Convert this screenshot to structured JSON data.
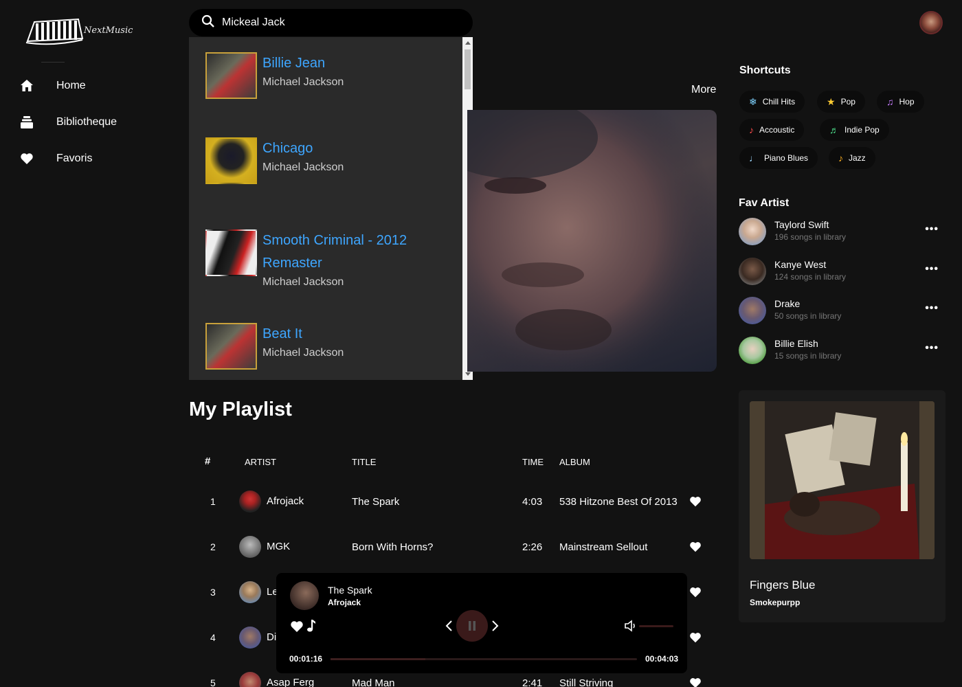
{
  "app": {
    "logo_text": "NextMusic"
  },
  "sidebar": {
    "items": [
      {
        "label": "Home",
        "icon": "home-icon"
      },
      {
        "label": "Bibliotheque",
        "icon": "library-icon"
      },
      {
        "label": "Favoris",
        "icon": "heart-icon"
      }
    ]
  },
  "search": {
    "value": "Mickeal Jack"
  },
  "results": [
    {
      "title": "Billie Jean",
      "artist": "Michael Jackson"
    },
    {
      "title": "Chicago",
      "artist": "Michael Jackson"
    },
    {
      "title": "Smooth Criminal - 2012 Remaster",
      "artist": "Michael Jackson"
    },
    {
      "title": "Beat It",
      "artist": "Michael Jackson"
    }
  ],
  "hero": {
    "more_label": "More"
  },
  "playlist": {
    "title": "My Playlist",
    "headers": {
      "num": "#",
      "artist": "ARTIST",
      "title": "TITLE",
      "time": "TIME",
      "album": "ALBUM"
    },
    "rows": [
      {
        "num": "1",
        "artist": "Afrojack",
        "title": "The Spark",
        "time": "4:03",
        "album": "538 Hitzone Best Of 2013"
      },
      {
        "num": "2",
        "artist": "MGK",
        "title": "Born With Horns?",
        "time": "2:26",
        "album": "Mainstream Sellout"
      },
      {
        "num": "3",
        "artist": "Le",
        "title": "",
        "time": "",
        "album": ""
      },
      {
        "num": "4",
        "artist": "Di",
        "title": "",
        "time": "",
        "album": ""
      },
      {
        "num": "5",
        "artist": "Asap Ferg",
        "title": "Mad Man",
        "time": "2:41",
        "album": "Still Striving"
      }
    ]
  },
  "player": {
    "title": "The Spark",
    "artist": "Afrojack",
    "elapsed": "00:01:16",
    "duration": "00:04:03",
    "progress": 0.31
  },
  "shortcuts": {
    "title": "Shortcuts",
    "items": [
      {
        "label": "Chill Hits",
        "icon": "snowflake-icon"
      },
      {
        "label": "Pop",
        "icon": "star-icon"
      },
      {
        "label": "Hop",
        "icon": "music-notes-icon"
      },
      {
        "label": "Accoustic",
        "icon": "guitar-icon"
      },
      {
        "label": "Indie Pop",
        "icon": "indie-icon"
      },
      {
        "label": "Piano Blues",
        "icon": "piano-icon"
      },
      {
        "label": "Jazz",
        "icon": "saxophone-icon"
      }
    ]
  },
  "fav_artists": {
    "title": "Fav Artist",
    "items": [
      {
        "name": "Taylord Swift",
        "sub": "196 songs in library"
      },
      {
        "name": "Kanye West",
        "sub": "124 songs in library"
      },
      {
        "name": "Drake",
        "sub": "50 songs in library"
      },
      {
        "name": "Billie Elish",
        "sub": "15 songs in library"
      }
    ]
  },
  "now_playing_card": {
    "title": "Fingers Blue",
    "artist": "Smokepurpp"
  }
}
